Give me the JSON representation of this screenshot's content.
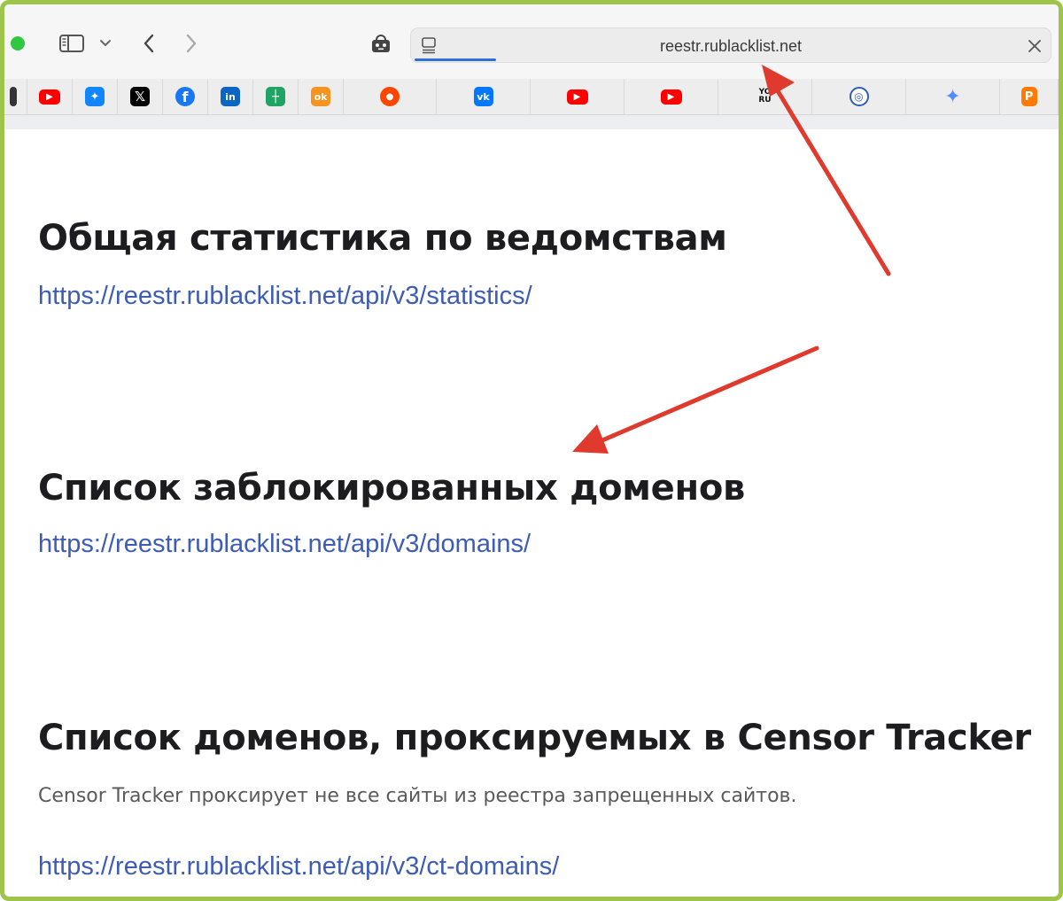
{
  "browser": {
    "address_url": "reestr.rublacklist.net",
    "favorites": [
      {
        "icon": "youtube-icon",
        "color": "#ff0000"
      },
      {
        "icon": "bluesky-icon",
        "color": "#1185fe"
      },
      {
        "icon": "x-icon",
        "color": "#000000"
      },
      {
        "icon": "facebook-icon",
        "color": "#1877f2"
      },
      {
        "icon": "linkedin-icon",
        "color": "#0a66c2"
      },
      {
        "icon": "sheets-icon",
        "color": "#1fa463"
      },
      {
        "icon": "odnoklassniki-icon",
        "color": "#f7931e"
      },
      {
        "icon": "reddit-icon",
        "color": "#ff4500"
      },
      {
        "icon": "vk-icon",
        "color": "#0077ff"
      },
      {
        "icon": "youtube-icon",
        "color": "#ff0000"
      },
      {
        "icon": "youtube-icon",
        "color": "#ff0000"
      },
      {
        "icon": "yo-ru-icon",
        "color": "#111111",
        "text": "YO RU"
      },
      {
        "icon": "emblem-icon",
        "color": "#2f5fb4"
      },
      {
        "icon": "gemini-icon",
        "color": "#4f8df7"
      },
      {
        "icon": "p-icon",
        "color": "#ff7a00",
        "text": "P"
      }
    ]
  },
  "sections": [
    {
      "heading": "Общая статистика по ведомствам",
      "link": "https://reestr.rublacklist.net/api/v3/statistics/"
    },
    {
      "heading": "Список заблокированных доменов",
      "link": "https://reestr.rublacklist.net/api/v3/domains/"
    },
    {
      "heading": "Список доменов, проксируемых в Censor Tracker",
      "note": "Censor Tracker проксирует не все сайты из реестра запрещенных сайтов.",
      "link": "https://reestr.rublacklist.net/api/v3/ct-domains/"
    }
  ],
  "annotation_color": "#e0392d"
}
